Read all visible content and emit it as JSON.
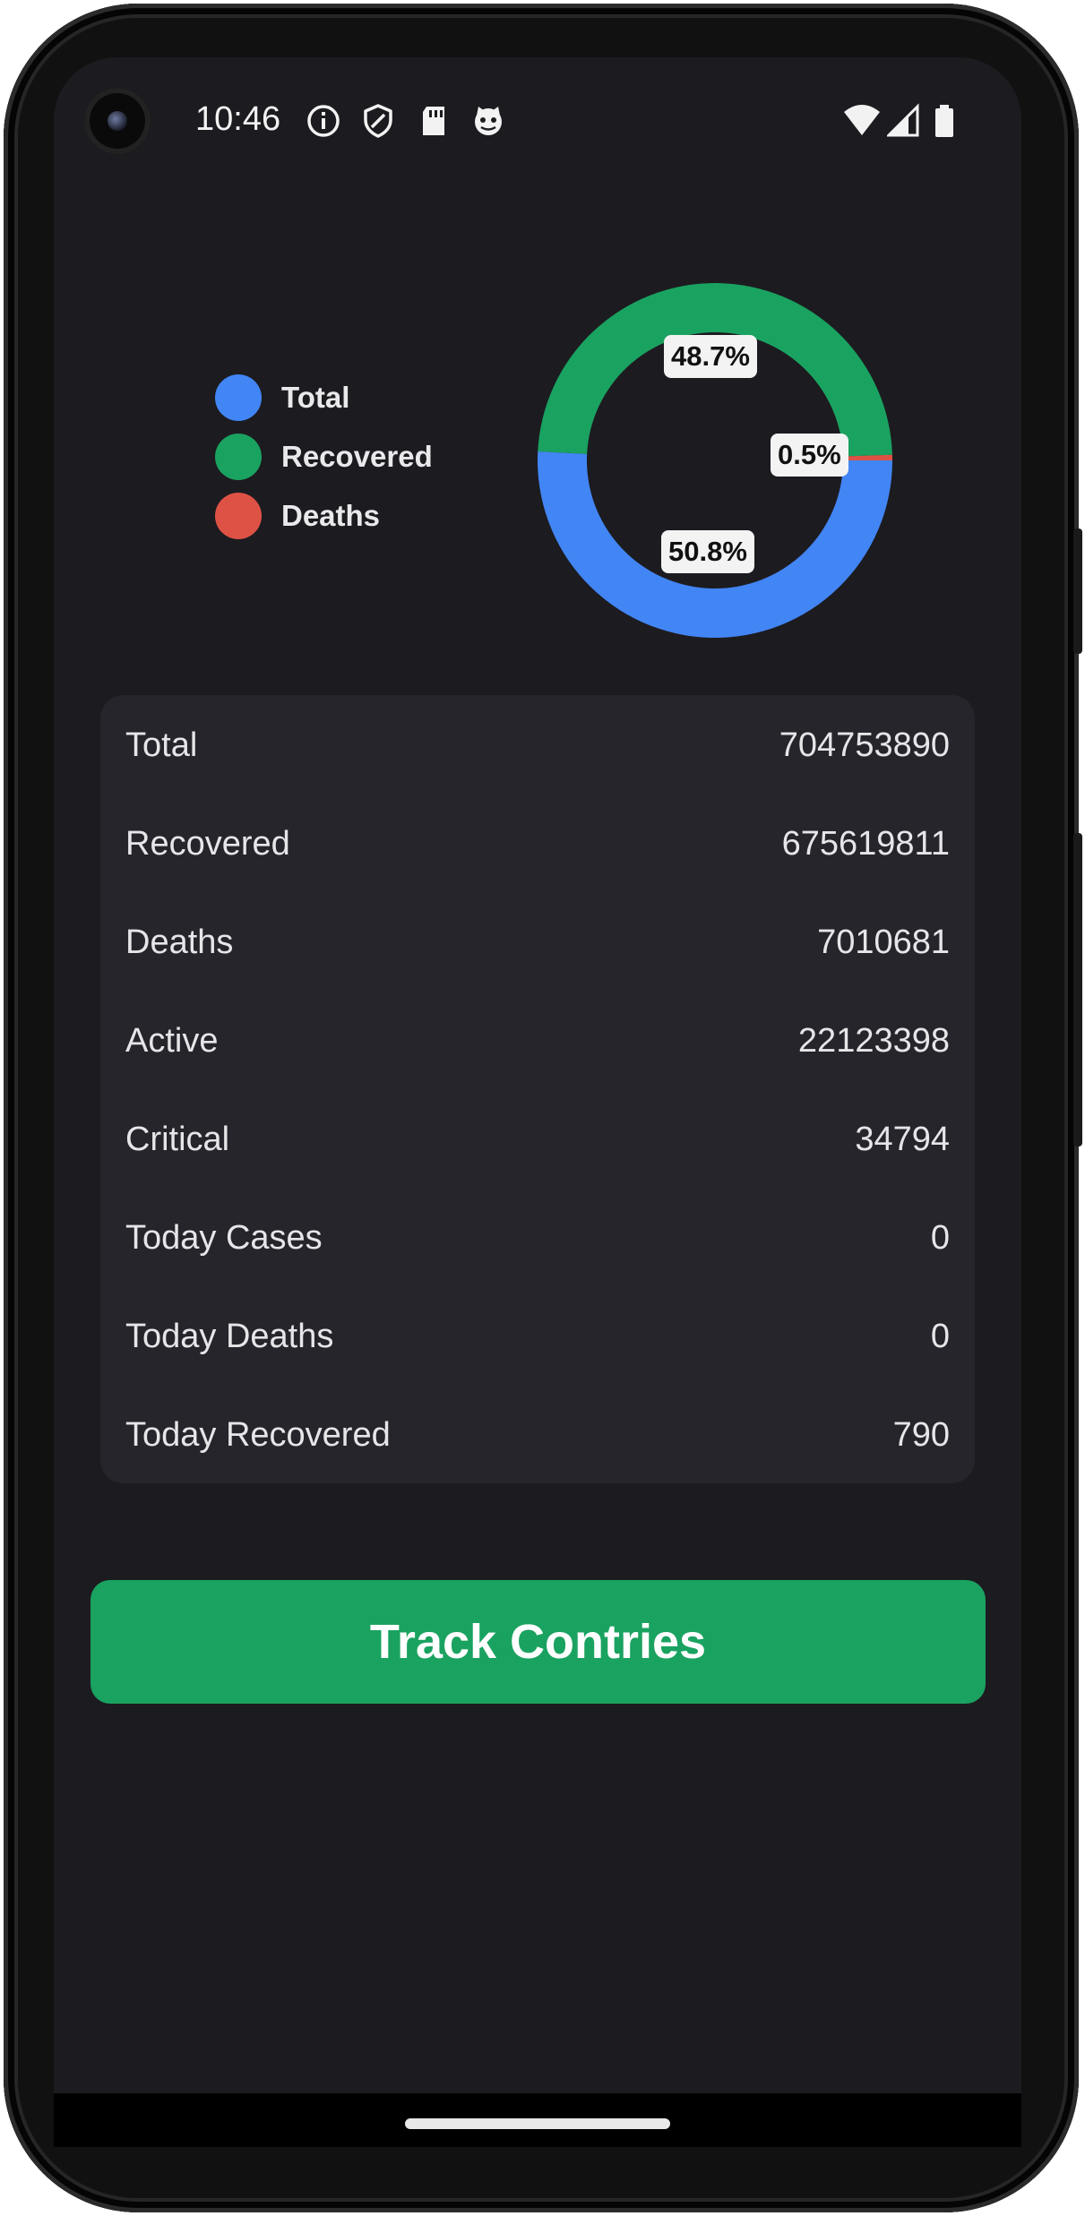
{
  "status_bar": {
    "time": "10:46",
    "left_icons": [
      "info-icon",
      "shield-icon",
      "sd-card-icon",
      "cat-face-icon"
    ],
    "right_icons": [
      "wifi-icon",
      "cell-signal-icon",
      "battery-icon"
    ]
  },
  "colors": {
    "total": "#4285f4",
    "recovered": "#1aa260",
    "deaths": "#de5246",
    "background": "#1c1b20",
    "card": "#26252b"
  },
  "legend": [
    {
      "label": "Total",
      "color": "#4285f4"
    },
    {
      "label": "Recovered",
      "color": "#1aa260"
    },
    {
      "label": "Deaths",
      "color": "#de5246"
    }
  ],
  "chart_data": {
    "type": "pie",
    "donut": true,
    "categories": [
      "Total",
      "Recovered",
      "Deaths"
    ],
    "values": [
      50.8,
      48.7,
      0.5
    ],
    "labels": [
      "50.8%",
      "48.7%",
      "0.5%"
    ],
    "colors": [
      "#4285f4",
      "#1aa260",
      "#de5246"
    ],
    "legend_position": "left"
  },
  "stats": [
    {
      "label": "Total",
      "value": "704753890"
    },
    {
      "label": "Recovered",
      "value": "675619811"
    },
    {
      "label": "Deaths",
      "value": "7010681"
    },
    {
      "label": "Active",
      "value": "22123398"
    },
    {
      "label": "Critical",
      "value": "34794"
    },
    {
      "label": "Today Cases",
      "value": "0"
    },
    {
      "label": "Today Deaths",
      "value": "0"
    },
    {
      "label": "Today Recovered",
      "value": "790"
    }
  ],
  "button": {
    "label": "Track Contries"
  }
}
